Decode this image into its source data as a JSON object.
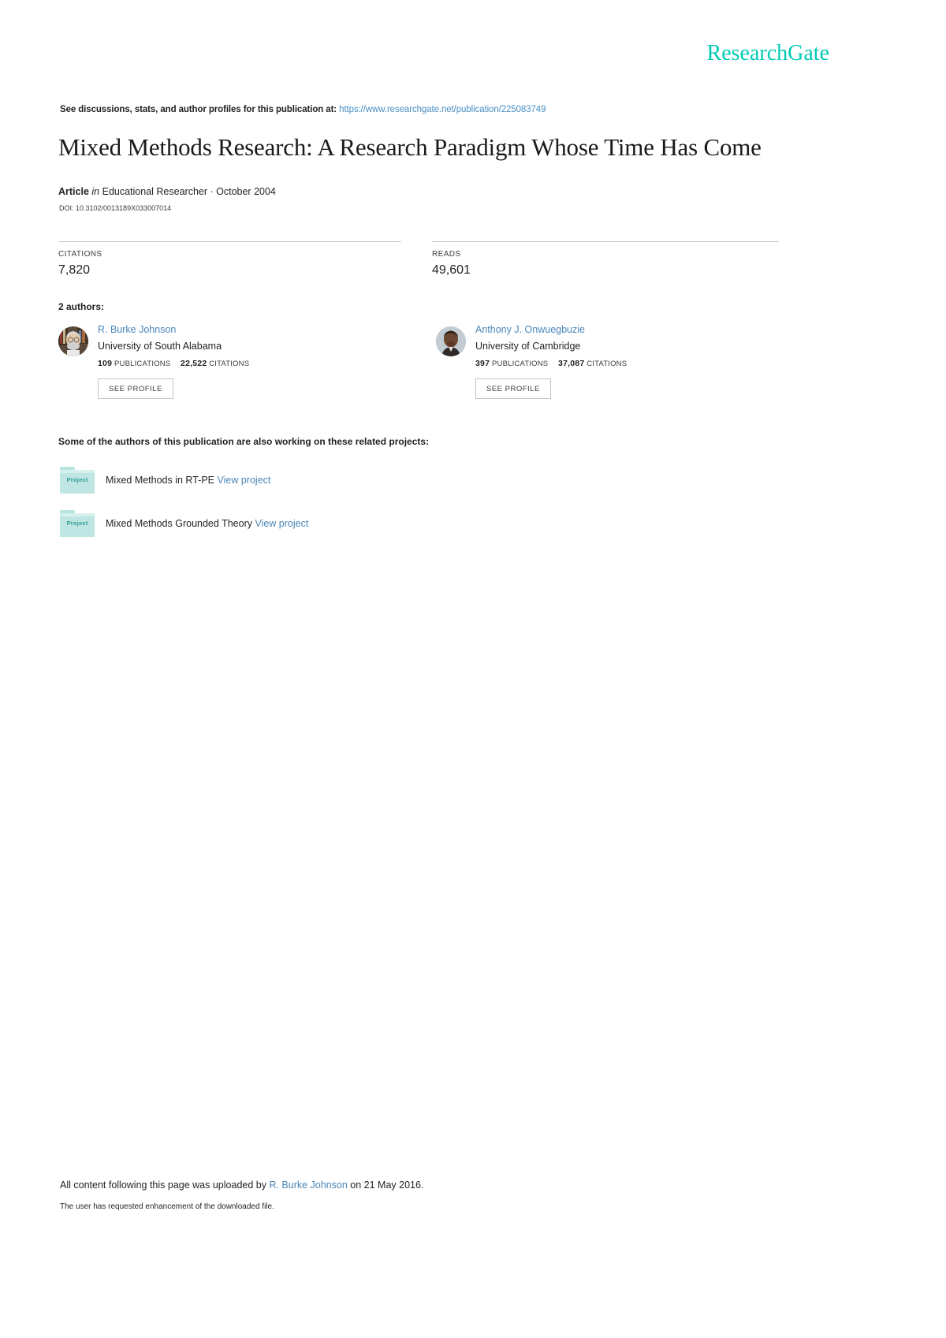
{
  "logo": {
    "text": "ResearchGate",
    "color": "#00ccb5"
  },
  "discussion": {
    "prefix": "See discussions, stats, and author profiles for this publication at:",
    "url": "https://www.researchgate.net/publication/225083749"
  },
  "publication": {
    "title": "Mixed Methods Research: A Research Paradigm Whose Time Has Come",
    "type": "Article",
    "in_word": "in",
    "venue": "Educational Researcher · October 2004",
    "doi": "DOI: 10.3102/0013189X033007014"
  },
  "stats": [
    {
      "label": "CITATIONS",
      "value": "7,820"
    },
    {
      "label": "READS",
      "value": "49,601"
    }
  ],
  "authors_heading": "2 authors:",
  "authors": [
    {
      "name": "R. Burke Johnson",
      "institution": "University of South Alabama",
      "publications": "109",
      "publications_label": "PUBLICATIONS",
      "citations": "22,522",
      "citations_label": "CITATIONS",
      "profile_button": "SEE PROFILE"
    },
    {
      "name": "Anthony J. Onwuegbuzie",
      "institution": "University of Cambridge",
      "publications": "397",
      "publications_label": "PUBLICATIONS",
      "citations": "37,087",
      "citations_label": "CITATIONS",
      "profile_button": "SEE PROFILE"
    }
  ],
  "projects_heading": "Some of the authors of this publication are also working on these related projects:",
  "projects": [
    {
      "badge": "Project",
      "title": "Mixed Methods in RT-PE",
      "link": "View project"
    },
    {
      "badge": "Project",
      "title": "Mixed Methods Grounded Theory",
      "link": "View project"
    }
  ],
  "footer": {
    "upload_prefix": "All content following this page was uploaded by ",
    "upload_author": "R. Burke Johnson",
    "upload_suffix": " on 21 May 2016.",
    "note": "The user has requested enhancement of the downloaded file."
  }
}
